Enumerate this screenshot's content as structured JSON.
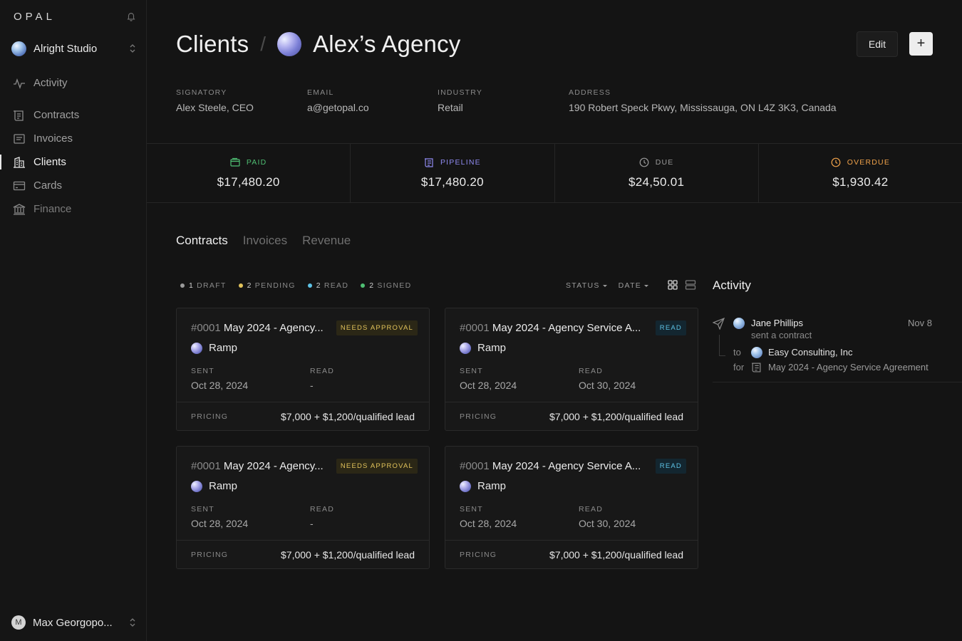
{
  "app": {
    "logo": "OPAL"
  },
  "workspace": {
    "name": "Alright Studio"
  },
  "nav": {
    "items": [
      {
        "label": "Activity"
      },
      {
        "label": "Contracts"
      },
      {
        "label": "Invoices"
      },
      {
        "label": "Clients"
      },
      {
        "label": "Cards"
      },
      {
        "label": "Finance"
      }
    ]
  },
  "user": {
    "initial": "M",
    "name": "Max Georgopo..."
  },
  "header": {
    "crumb_root": "Clients",
    "separator": "/",
    "client_name": "Alex’s Agency",
    "edit_label": "Edit",
    "add_label": "+"
  },
  "meta": [
    {
      "label": "SIGNATORY",
      "value": "Alex Steele, CEO"
    },
    {
      "label": "EMAIL",
      "value": "a@getopal.co"
    },
    {
      "label": "INDUSTRY",
      "value": "Retail"
    },
    {
      "label": "ADDRESS",
      "value": "190 Robert Speck Pkwy, Mississauga, ON L4Z 3K3, Canada"
    }
  ],
  "stats": [
    {
      "label": "PAID",
      "value": "$17,480.20",
      "color": "#4fbf73"
    },
    {
      "label": "PIPELINE",
      "value": "$17,480.20",
      "color": "#8f8af0"
    },
    {
      "label": "DUE",
      "value": "$24,50.01",
      "color": "#9a9a9a"
    },
    {
      "label": "OVERDUE",
      "value": "$1,930.42",
      "color": "#f0a24a"
    }
  ],
  "tabs": [
    {
      "label": "Contracts"
    },
    {
      "label": "Invoices"
    },
    {
      "label": "Revenue"
    }
  ],
  "filters": [
    {
      "count": "1",
      "label": "DRAFT",
      "color": "#9a9a9a"
    },
    {
      "count": "2",
      "label": "PENDING",
      "color": "#e2c35b"
    },
    {
      "count": "2",
      "label": "READ",
      "color": "#5ec3e6"
    },
    {
      "count": "2",
      "label": "SIGNED",
      "color": "#4fbf73"
    }
  ],
  "sorts": {
    "status": "STATUS",
    "date": "DATE"
  },
  "contracts": [
    {
      "number": "#0001",
      "title": "May 2024 - Agency...",
      "badge": "NEEDS APPROVAL",
      "client": "Ramp",
      "sent_label": "SENT",
      "sent": "Oct 28, 2024",
      "read_label": "READ",
      "read": "-",
      "pricing_label": "PRICING",
      "pricing": "$7,000 + $1,200/qualified lead"
    },
    {
      "number": "#0001",
      "title": "May 2024 - Agency Service A...",
      "badge": "READ",
      "client": "Ramp",
      "sent_label": "SENT",
      "sent": "Oct 28, 2024",
      "read_label": "READ",
      "read": "Oct 30, 2024",
      "pricing_label": "PRICING",
      "pricing": "$7,000 + $1,200/qualified lead"
    },
    {
      "number": "#0001",
      "title": "May 2024 - Agency...",
      "badge": "NEEDS APPROVAL",
      "client": "Ramp",
      "sent_label": "SENT",
      "sent": "Oct 28, 2024",
      "read_label": "READ",
      "read": "-",
      "pricing_label": "PRICING",
      "pricing": "$7,000 + $1,200/qualified lead"
    },
    {
      "number": "#0001",
      "title": "May 2024 - Agency Service A...",
      "badge": "READ",
      "client": "Ramp",
      "sent_label": "SENT",
      "sent": "Oct 28, 2024",
      "read_label": "READ",
      "read": "Oct 30, 2024",
      "pricing_label": "PRICING",
      "pricing": "$7,000 + $1,200/qualified lead"
    }
  ],
  "activity": {
    "title": "Activity",
    "items": [
      {
        "actor": "Jane Phillips",
        "date": "Nov 8",
        "action": "sent a contract",
        "to_label": "to",
        "to": "Easy Consulting, Inc",
        "for_label": "for",
        "document": "May 2024 - Agency Service Agreement"
      }
    ]
  }
}
